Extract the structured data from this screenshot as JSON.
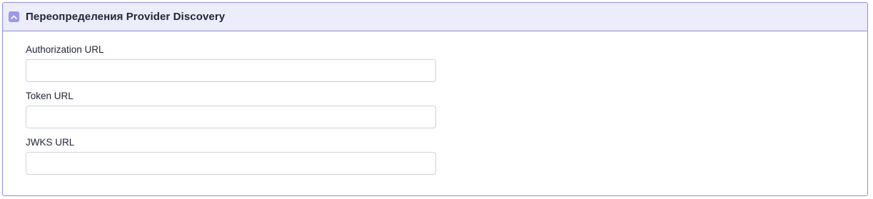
{
  "section": {
    "title": "Переопределения Provider Discovery",
    "collapse_icon": "chevron-up-icon",
    "accent_color": "#9a9ae6",
    "header_background": "#ececfb",
    "border_color": "#8f8fdc"
  },
  "fields": [
    {
      "label": "Authorization URL",
      "value": "",
      "placeholder": ""
    },
    {
      "label": "Token URL",
      "value": "",
      "placeholder": ""
    },
    {
      "label": "JWKS URL",
      "value": "",
      "placeholder": ""
    }
  ]
}
